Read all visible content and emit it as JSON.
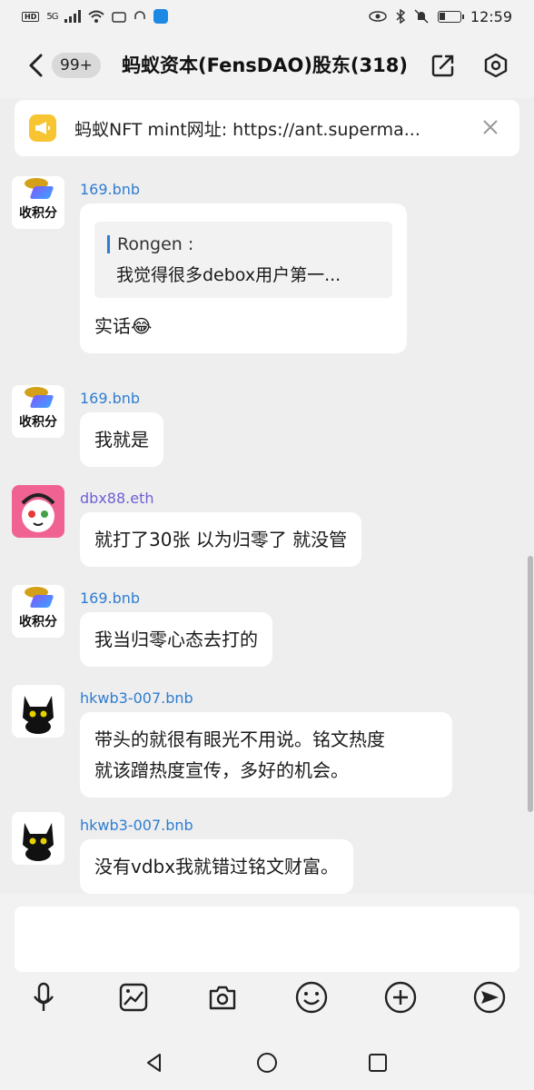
{
  "status_bar": {
    "hd": "HD",
    "network": "5G",
    "time": "12:59",
    "battery_level": 0.3
  },
  "header": {
    "back_icon": "chevron-left-icon",
    "unread_count": "99+",
    "title": "蚂蚁资本(FensDAO)股东(318)",
    "share_icon": "share-icon",
    "settings_icon": "hexagon-settings-icon"
  },
  "notice": {
    "icon": "megaphone-icon",
    "text": "蚂蚁NFT mint网址: https://ant.superma...",
    "close_icon": "close-icon"
  },
  "messages": [
    {
      "sender": "169.bnb",
      "avatar_label": "收积分",
      "quote_name": "Rongen :",
      "quote_text": "我觉得很多debox用户第一...",
      "text": "实话😂"
    },
    {
      "sender": "169.bnb",
      "avatar_label": "收积分",
      "text": "我就是"
    },
    {
      "sender": "dbx88.eth",
      "text": "就打了30张 以为归零了 就没管"
    },
    {
      "sender": "169.bnb",
      "avatar_label": "收积分",
      "text": "我当归零心态去打的"
    },
    {
      "sender": "hkwb3-007.bnb",
      "text_line1": "带头的就很有眼光不用说。铭文热度",
      "text_line2": "就该蹭热度宣传，多好的机会。"
    },
    {
      "sender": "hkwb3-007.bnb",
      "text": "没有vdbx我就错过铭文财富。"
    }
  ],
  "input": {
    "placeholder": ""
  },
  "toolbar": {
    "icons": [
      "microphone-icon",
      "image-icon",
      "camera-icon",
      "emoji-icon",
      "plus-icon",
      "send-icon"
    ]
  },
  "navigation": {
    "icons": [
      "back-triangle-icon",
      "home-circle-icon",
      "recents-square-icon"
    ]
  },
  "colors": {
    "accent": "#2e7dd1",
    "background": "#eeeeee",
    "notice_icon": "#f7c531"
  }
}
